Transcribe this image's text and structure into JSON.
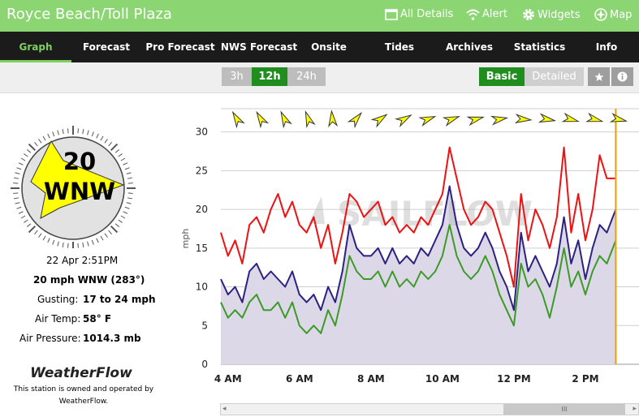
{
  "title": "Royce Beach/Toll Plaza",
  "top_links": [
    {
      "label": "All Details",
      "icon": "window-icon"
    },
    {
      "label": "Alert",
      "icon": "wifi-icon"
    },
    {
      "label": "Widgets",
      "icon": "gear-icon"
    },
    {
      "label": "Map",
      "icon": "compass-icon"
    }
  ],
  "nav": [
    "Graph",
    "Forecast",
    "Pro Forecast",
    "NWS Forecast",
    "Onsite",
    "Tides",
    "Archives",
    "Statistics",
    "Info"
  ],
  "nav_active": "Graph",
  "range_buttons": [
    "3h",
    "12h",
    "24h"
  ],
  "range_selected": "12h",
  "view_buttons": [
    "Basic",
    "Detailed"
  ],
  "view_selected": "Basic",
  "icon_buttons": [
    "star-icon",
    "info-icon"
  ],
  "station": {
    "speed": "20",
    "direction": "WNW",
    "datetime": "22 Apr 2:51PM",
    "wind_line": "20 mph WNW (283°)",
    "gusting_label": "Gusting:",
    "gusting_value": "17 to 24 mph",
    "air_temp_label": "Air Temp:",
    "air_temp_value": "58° F",
    "pressure_label": "Air Pressure:",
    "pressure_value": "1014.3 mb",
    "brand": "WeatherFlow",
    "credit_line1": "This station is owned and operated by",
    "credit_line2": "WeatherFlow."
  },
  "watermark": "SAILFLOW",
  "colors": {
    "gust": "#ee1111",
    "avg": "#2c2181",
    "lull": "#3c9a26",
    "fill": "#dcd8e8",
    "now_line": "#f0a000",
    "arrow": "#ffff00"
  },
  "chart_data": {
    "type": "line",
    "ylabel": "mph",
    "ylim": [
      0,
      33
    ],
    "y_ticks": [
      0,
      5,
      10,
      15,
      20,
      25,
      30
    ],
    "x_range": [
      3.8,
      15.5
    ],
    "x_ticks": [
      {
        "x": 4,
        "label": "4 AM"
      },
      {
        "x": 6,
        "label": "6 AM"
      },
      {
        "x": 8,
        "label": "8 AM"
      },
      {
        "x": 10,
        "label": "10 AM"
      },
      {
        "x": 12,
        "label": "12 PM"
      },
      {
        "x": 14,
        "label": "2 PM"
      }
    ],
    "now_x": 14.85,
    "wind_dir_hours": [
      4.25,
      4.92,
      5.58,
      6.25,
      6.92,
      7.58,
      8.25,
      8.92,
      9.58,
      10.25,
      10.92,
      11.58,
      12.25,
      12.92,
      13.58,
      14.25,
      14.92
    ],
    "wind_dir_degrees": [
      150,
      150,
      155,
      160,
      175,
      220,
      235,
      240,
      250,
      250,
      255,
      260,
      275,
      280,
      285,
      285,
      283
    ],
    "series": [
      {
        "name": "gust",
        "x": [
          3.8,
          4.0,
          4.2,
          4.4,
          4.6,
          4.8,
          5.0,
          5.2,
          5.4,
          5.6,
          5.8,
          6.0,
          6.2,
          6.4,
          6.6,
          6.8,
          7.0,
          7.2,
          7.4,
          7.6,
          7.8,
          8.0,
          8.2,
          8.4,
          8.6,
          8.8,
          9.0,
          9.2,
          9.4,
          9.6,
          9.8,
          10.0,
          10.2,
          10.4,
          10.6,
          10.8,
          11.0,
          11.2,
          11.4,
          11.6,
          11.8,
          12.0,
          12.2,
          12.4,
          12.6,
          12.8,
          13.0,
          13.2,
          13.4,
          13.6,
          13.8,
          14.0,
          14.2,
          14.4,
          14.6,
          14.85
        ],
        "values": [
          17,
          14,
          16,
          13,
          18,
          19,
          17,
          20,
          22,
          19,
          21,
          18,
          17,
          19,
          15,
          18,
          13,
          17,
          22,
          21,
          19,
          20,
          21,
          18,
          19,
          17,
          18,
          17,
          19,
          18,
          20,
          22,
          28,
          24,
          20,
          18,
          19,
          21,
          20,
          17,
          14,
          10,
          22,
          16,
          20,
          18,
          15,
          19,
          28,
          17,
          22,
          16,
          20,
          27,
          24,
          24
        ]
      },
      {
        "name": "avg",
        "x": [
          3.8,
          4.0,
          4.2,
          4.4,
          4.6,
          4.8,
          5.0,
          5.2,
          5.4,
          5.6,
          5.8,
          6.0,
          6.2,
          6.4,
          6.6,
          6.8,
          7.0,
          7.2,
          7.4,
          7.6,
          7.8,
          8.0,
          8.2,
          8.4,
          8.6,
          8.8,
          9.0,
          9.2,
          9.4,
          9.6,
          9.8,
          10.0,
          10.2,
          10.4,
          10.6,
          10.8,
          11.0,
          11.2,
          11.4,
          11.6,
          11.8,
          12.0,
          12.2,
          12.4,
          12.6,
          12.8,
          13.0,
          13.2,
          13.4,
          13.6,
          13.8,
          14.0,
          14.2,
          14.4,
          14.6,
          14.85
        ],
        "values": [
          11,
          9,
          10,
          8,
          12,
          13,
          11,
          12,
          11,
          10,
          12,
          9,
          8,
          9,
          7,
          10,
          8,
          12,
          18,
          15,
          14,
          14,
          15,
          13,
          15,
          13,
          14,
          13,
          15,
          14,
          16,
          18,
          23,
          18,
          15,
          14,
          15,
          17,
          15,
          12,
          10,
          7,
          17,
          12,
          14,
          12,
          10,
          13,
          19,
          13,
          16,
          11,
          15,
          18,
          17,
          20
        ]
      },
      {
        "name": "lull",
        "x": [
          3.8,
          4.0,
          4.2,
          4.4,
          4.6,
          4.8,
          5.0,
          5.2,
          5.4,
          5.6,
          5.8,
          6.0,
          6.2,
          6.4,
          6.6,
          6.8,
          7.0,
          7.2,
          7.4,
          7.6,
          7.8,
          8.0,
          8.2,
          8.4,
          8.6,
          8.8,
          9.0,
          9.2,
          9.4,
          9.6,
          9.8,
          10.0,
          10.2,
          10.4,
          10.6,
          10.8,
          11.0,
          11.2,
          11.4,
          11.6,
          11.8,
          12.0,
          12.2,
          12.4,
          12.6,
          12.8,
          13.0,
          13.2,
          13.4,
          13.6,
          13.8,
          14.0,
          14.2,
          14.4,
          14.6,
          14.85
        ],
        "values": [
          8,
          6,
          7,
          6,
          8,
          9,
          7,
          7,
          8,
          6,
          8,
          5,
          4,
          5,
          4,
          7,
          5,
          9,
          14,
          12,
          11,
          11,
          12,
          10,
          12,
          10,
          11,
          10,
          12,
          11,
          12,
          14,
          18,
          14,
          12,
          11,
          12,
          14,
          12,
          9,
          7,
          5,
          13,
          10,
          11,
          9,
          6,
          10,
          15,
          10,
          12,
          9,
          12,
          14,
          13,
          16
        ]
      }
    ]
  }
}
